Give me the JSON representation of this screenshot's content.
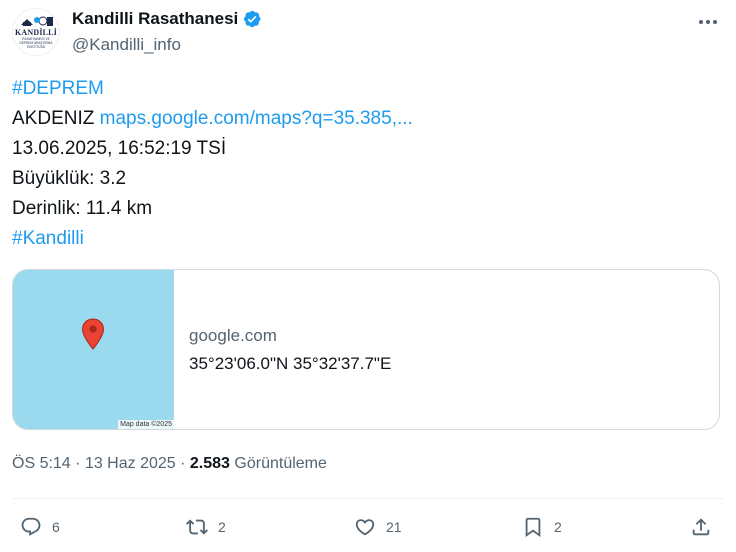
{
  "tweet": {
    "author": {
      "display_name": "Kandilli Rasathanesi",
      "handle": "@Kandilli_info",
      "avatar_logo_text": "KANDİLLİ",
      "avatar_logo_subtext": "RASATHANESİ VE DEPREM ARAŞTIRMA ENSTİTÜSÜ",
      "verified_color": "#1d9bf0"
    },
    "lines": {
      "hashtag_deprem": "#DEPREM",
      "location": "AKDENIZ",
      "map_link": "maps.google.com/maps?q=35.385,...",
      "datetime": "13.06.2025, 16:52:19 TSİ",
      "magnitude": "Büyüklük: 3.2",
      "depth": "Derinlik: 11.4 km",
      "hashtag_kandilli": "#Kandilli"
    },
    "card": {
      "domain": "google.com",
      "title": "35°23'06.0\"N 35°32'37.7\"E",
      "map_credit": "Map data ©2025",
      "map_color": "#9bd9ef",
      "pin_color": "#ea4335"
    },
    "meta": {
      "time": "ÖS 5:14",
      "date": "13 Haz 2025",
      "views_count": "2.583",
      "views_label": "Görüntüleme"
    },
    "actions": {
      "replies": "6",
      "reposts": "2",
      "likes": "21",
      "bookmarks": "2"
    },
    "colors": {
      "link": "#1d9bf0",
      "secondary_text": "#536471",
      "primary_text": "#0f1419"
    }
  }
}
